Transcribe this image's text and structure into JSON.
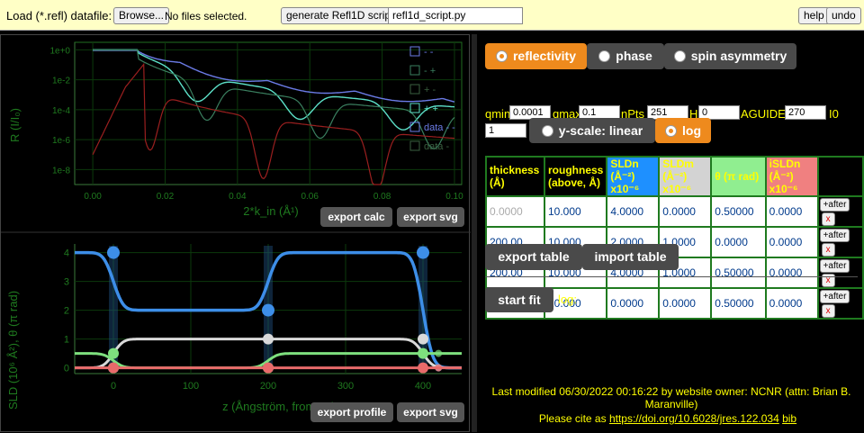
{
  "topbar": {
    "load_label": "Load (*.refl) datafile:",
    "browse_label": "Browse...",
    "file_status": "No files selected.",
    "generate_label": "generate Refl1D script",
    "script_name": "refl1d_script.py",
    "help_label": "help",
    "undo_label": "undo"
  },
  "reflectivity_plot": {
    "ylabel": "R (I/I₀)",
    "xlabel": "2*k_in (Å¹)",
    "y_ticks": [
      "1e+0",
      "1e-2",
      "1e-4",
      "1e-6",
      "1e-8"
    ],
    "x_ticks": [
      "0.00",
      "0.02",
      "0.04",
      "0.06",
      "0.08",
      "0.10"
    ],
    "legend": [
      "- -",
      "- +",
      "+ -",
      "+ +",
      "data - -",
      "data -"
    ],
    "export_calc_label": "export calc",
    "export_svg_label": "export svg"
  },
  "profile_plot": {
    "ylabel": "SLD (10⁶ Å²), θ (π rad)",
    "xlabel": "z (Ångström, from sub",
    "y_ticks": [
      "4",
      "3",
      "2",
      "1",
      "0"
    ],
    "x_ticks": [
      "0",
      "100",
      "200",
      "300",
      "400"
    ],
    "export_profile_label": "export profile",
    "export_svg_label": "export svg"
  },
  "chart_data": [
    {
      "type": "line",
      "name": "reflectivity",
      "xlabel": "2*k_in (Å¹)",
      "ylabel": "R (I/I₀)",
      "xlim": [
        -0.005,
        0.102
      ],
      "ylim_log10": [
        -9,
        0.5
      ],
      "log_y": true,
      "legend": [
        "- -",
        "- +",
        "+ -",
        "+ +",
        "data - -",
        "data -"
      ],
      "series_colors": [
        "#6b7be6",
        "#3a7f5f",
        "#9a1f1f",
        "#5ce0c8"
      ]
    },
    {
      "type": "line",
      "name": "sld_profile",
      "xlabel": "z (Ångström, from sub",
      "ylabel": "SLD (10⁶ Å²), θ (π rad)",
      "xlim": [
        -50,
        450
      ],
      "ylim": [
        -0.2,
        4.3
      ],
      "series": [
        {
          "color": "#3d8ee8",
          "points": [
            [
              -50,
              4
            ],
            [
              0,
              4
            ],
            [
              200,
              2
            ],
            [
              400,
              4
            ],
            [
              450,
              0
            ]
          ],
          "values": [
            4.0,
            2.0,
            4.0,
            0.0
          ]
        },
        {
          "color": "#d9d9d9",
          "values": [
            0.0,
            1.0,
            1.0,
            0.0
          ]
        },
        {
          "color": "#7ee07e",
          "values": [
            0.5,
            0.0,
            0.5,
            0.5
          ]
        },
        {
          "color": "#e86a6a",
          "values": [
            0.0,
            0.0,
            0.0,
            0.0
          ]
        }
      ],
      "interfaces": [
        0,
        200,
        400
      ]
    }
  ],
  "mode_tabs": [
    {
      "label": "reflectivity",
      "active": true
    },
    {
      "label": "phase",
      "active": false
    },
    {
      "label": "spin asymmetry",
      "active": false
    }
  ],
  "params": {
    "qmin_label": "qmin",
    "qmin_value": "0.0001",
    "qmax_label": "qmax",
    "qmax_value": "0.1",
    "npts_label": "nPts",
    "npts_value": "251",
    "h_label": "H",
    "h_value": "0",
    "aguide_label": "AGUIDE",
    "aguide_value": "270",
    "i0_label": "I0",
    "i0_value": "1"
  },
  "yscale": {
    "linear_label": "y-scale: linear",
    "log_label": "log",
    "selected": "log"
  },
  "table": {
    "headers": [
      {
        "text": "thickness (Å)",
        "bg": "#000000",
        "color": "#ffff00"
      },
      {
        "text": "roughness (above, Å)",
        "bg": "#000000",
        "color": "#ffff00"
      },
      {
        "text": "SLDn (Å⁻²) x10⁻⁶",
        "bg": "#1e90ff",
        "color": "#ffff00"
      },
      {
        "text": "SLDm (Å⁻²) x10⁻⁶",
        "bg": "#d3d3d3",
        "color": "#ffff00"
      },
      {
        "text": "θ (π rad)",
        "bg": "#90ee90",
        "color": "#ffff00"
      },
      {
        "text": "iSLDn (Å⁻²) x10⁻⁶",
        "bg": "#f08080",
        "color": "#ffff00"
      }
    ],
    "rows": [
      {
        "cells": [
          "0.0000",
          "10.000",
          "4.0000",
          "0.0000",
          "0.50000",
          "0.0000"
        ],
        "dim_first": true,
        "dim_all": false
      },
      {
        "cells": [
          "200.00",
          "10.000",
          "2.0000",
          "1.0000",
          "0.0000",
          "0.0000"
        ],
        "dim_first": false,
        "dim_all": false
      },
      {
        "cells": [
          "200.00",
          "10.000",
          "4.0000",
          "1.0000",
          "0.50000",
          "0.0000"
        ],
        "dim_first": false,
        "dim_all": false
      },
      {
        "cells": [
          "0.0000",
          "10.000",
          "0.0000",
          "0.0000",
          "0.50000",
          "0.0000"
        ],
        "dim_first": true,
        "dim_all": false
      }
    ],
    "after_label": "+after",
    "delete_label": "x"
  },
  "table_actions": {
    "export_label": "export table",
    "import_label": "import table"
  },
  "fit": {
    "start_label": "start fit",
    "log_label": "log:"
  },
  "footer": {
    "modified_line": "Last modified 06/30/2022 00:16:22 by website owner: NCNR (attn: Brian B. Maranville)",
    "cite_prefix": "Please cite as",
    "doi_link": "https://doi.org/10.6028/jres.122.034",
    "bib_link": "bib"
  }
}
